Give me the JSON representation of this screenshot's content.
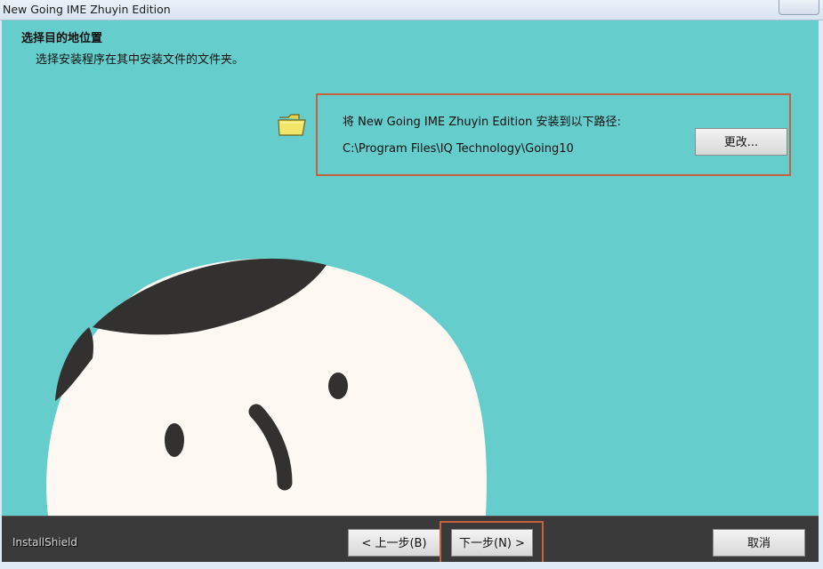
{
  "window": {
    "title": "New Going IME Zhuyin Edition"
  },
  "page": {
    "heading": "选择目的地位置",
    "subheading": "选择安装程序在其中安装文件的文件夹。"
  },
  "destination": {
    "label": "将 New Going IME Zhuyin Edition 安装到以下路径:",
    "path": "C:\\Program Files\\IQ Technology\\Going10",
    "change_label": "更改..."
  },
  "footer": {
    "brand": "InstallShield",
    "back_label": "< 上一步(B)",
    "next_label": "下一步(N) >",
    "cancel_label": "取消"
  },
  "colors": {
    "background": "#65cdcb",
    "highlight": "#c6603d",
    "footer": "#3a3a3a"
  }
}
